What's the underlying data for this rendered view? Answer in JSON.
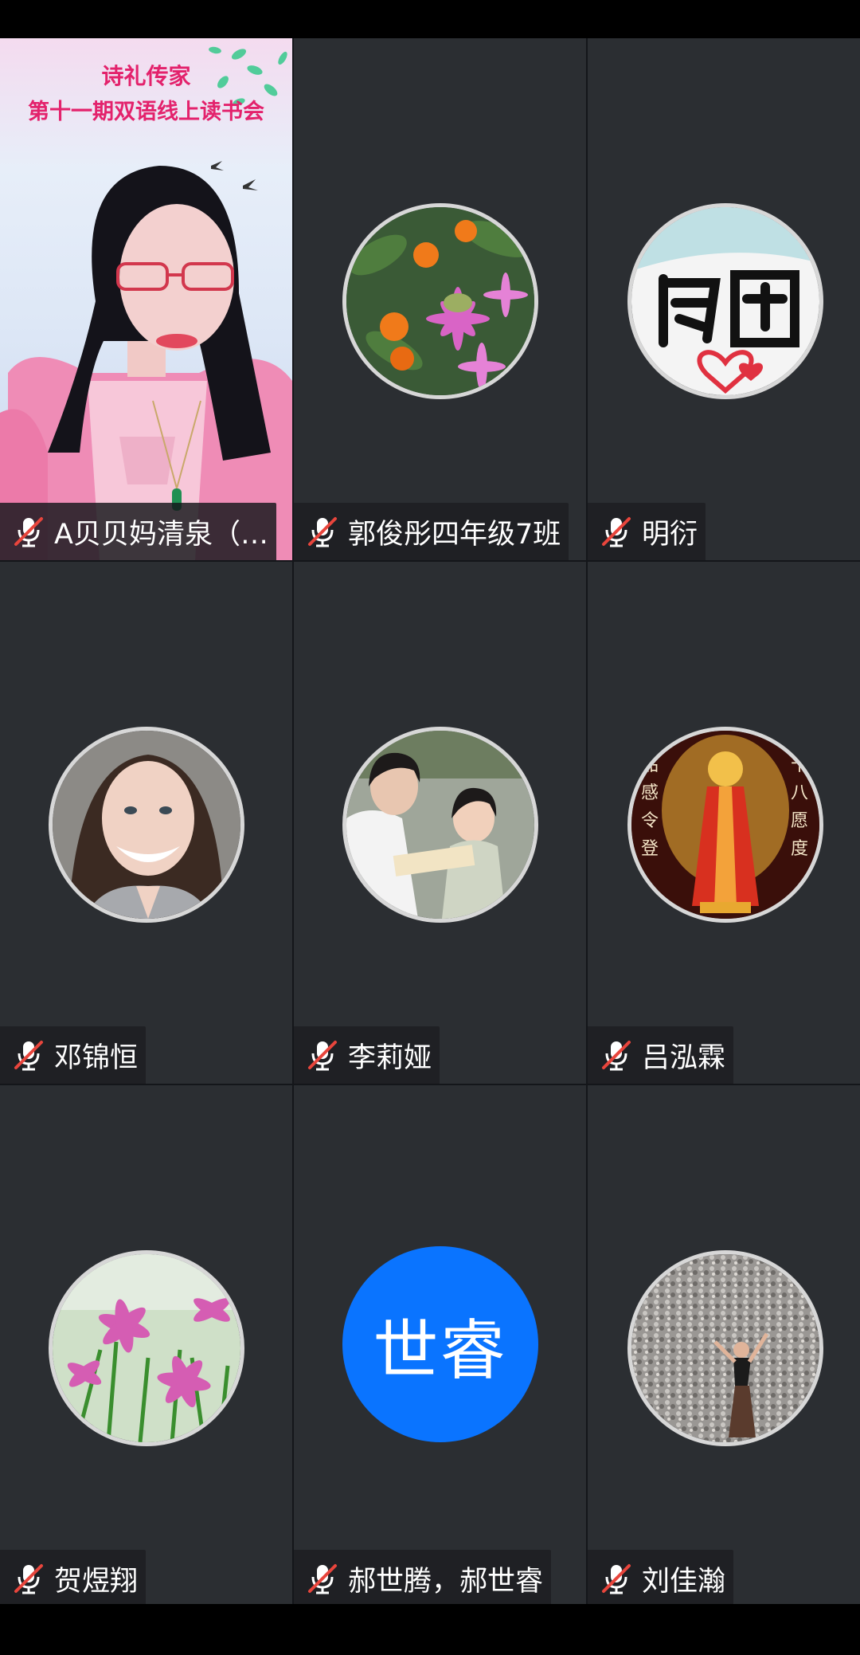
{
  "participants": [
    {
      "name": "A贝贝妈清泉（…",
      "muted": true,
      "type": "video",
      "video_title_1": "诗礼传家",
      "video_title_2": "第十一期双语线上读书会"
    },
    {
      "name": "郭俊彤四年级7班",
      "muted": true,
      "type": "avatar",
      "avatar_theme": "orange-flowers-bird"
    },
    {
      "name": "明衍",
      "muted": true,
      "type": "avatar",
      "avatar_theme": "calligraphy-heart"
    },
    {
      "name": "邓锦恒",
      "muted": true,
      "type": "avatar",
      "avatar_theme": "portrait-woman"
    },
    {
      "name": "李莉娅",
      "muted": true,
      "type": "avatar",
      "avatar_theme": "mother-daughter-reading"
    },
    {
      "name": "吕泓霖",
      "muted": true,
      "type": "avatar",
      "avatar_theme": "buddha"
    },
    {
      "name": "贺煜翔",
      "muted": true,
      "type": "avatar",
      "avatar_theme": "pink-lilies"
    },
    {
      "name": "郝世腾，郝世睿",
      "muted": true,
      "type": "text-avatar",
      "avatar_text": "世睿",
      "avatar_color": "#0a74ff"
    },
    {
      "name": "刘佳瀚",
      "muted": true,
      "type": "avatar",
      "avatar_theme": "gravel-dancer"
    }
  ],
  "colors": {
    "tile_bg": "#2b2e32",
    "muted_icon": "#e8453c",
    "text_avatar_bg": "#0a74ff",
    "video_title": "#e3226c"
  }
}
